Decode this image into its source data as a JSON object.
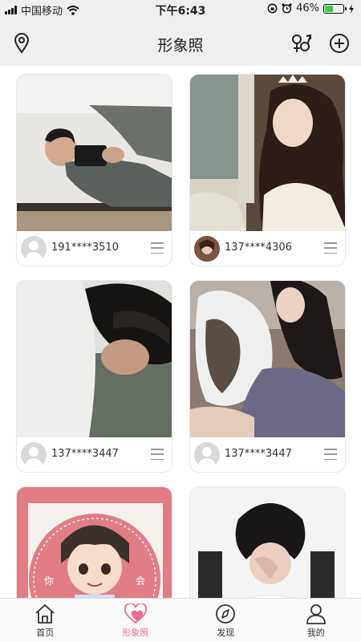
{
  "status_bar": {
    "carrier": "中国移动",
    "time": "下午6:43",
    "battery_pct_label": "46%",
    "battery_level": 0.46
  },
  "header": {
    "title": "形象照",
    "location_icon": "location-pin-icon",
    "gender_icon": "gender-filter-icon",
    "add_icon": "plus-circle-icon"
  },
  "cards": [
    {
      "user": "191****3510",
      "avatar": "default"
    },
    {
      "user": "137****4306",
      "avatar": "photo"
    },
    {
      "user": "137****3447",
      "avatar": "default"
    },
    {
      "user": "137****3447",
      "avatar": "default"
    },
    {
      "user": "",
      "avatar": "default",
      "badge_left": "你",
      "badge_right": "会"
    },
    {
      "user": "",
      "avatar": "default"
    }
  ],
  "tabbar": {
    "tabs": [
      {
        "label": "首页",
        "icon": "home-icon"
      },
      {
        "label": "形象照",
        "icon": "heart-icon"
      },
      {
        "label": "发现",
        "icon": "compass-icon"
      },
      {
        "label": "我的",
        "icon": "profile-icon"
      }
    ],
    "active_index": 1
  },
  "colors": {
    "accent": "#f06a8f",
    "header_bg": "#efefef",
    "battery": "#3ecb3e"
  }
}
